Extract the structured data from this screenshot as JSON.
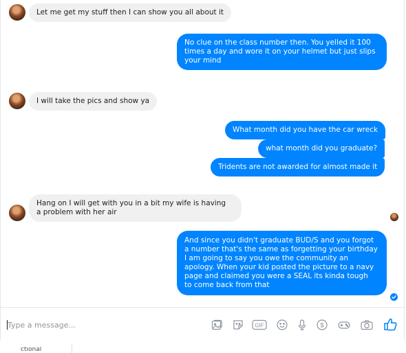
{
  "conversation": {
    "messages": [
      {
        "direction": "incoming",
        "text": "Let me get my stuff then I can show you all about it"
      },
      {
        "direction": "outgoing",
        "lines": [
          "No clue on the class number then. You yelled it 100",
          "times a day and wore it on your helmet but just slips",
          "your mind"
        ]
      },
      {
        "direction": "incoming",
        "text": "I will take the pics and show ya"
      },
      {
        "direction": "outgoing",
        "text": "What month did you have the car wreck"
      },
      {
        "direction": "outgoing",
        "text": "what month did you graduate?"
      },
      {
        "direction": "outgoing",
        "text": "Tridents are not awarded for almost made it"
      },
      {
        "direction": "incoming",
        "lines": [
          "Hang on I will get with you in a bit my wife is having",
          "a problem with her air"
        ]
      },
      {
        "direction": "outgoing",
        "lines": [
          "And since you didn't graduate BUD/S and you forgot",
          "a number that's the same as forgetting your birthday",
          "I am going to say you owe the community an",
          "apology. When your kid posted the picture to a navy",
          "page and claimed you were a SEAL its kinda tough",
          "to come back from that"
        ]
      }
    ]
  },
  "composer": {
    "placeholder": "Type a message...",
    "icons": [
      "sticker-gallery-icon",
      "sticker-icon",
      "gif-icon",
      "emoji-icon",
      "microphone-icon",
      "payment-icon",
      "game-icon",
      "camera-icon",
      "thumbs-up-icon"
    ],
    "gif_label": "GIF",
    "payment_label": "$"
  },
  "footer": {
    "text": "ctional"
  },
  "colors": {
    "outgoing_bubble": "#0084ff",
    "incoming_bubble": "#f1f0f0",
    "icon": "#8d949e",
    "like": "#0084ff"
  }
}
